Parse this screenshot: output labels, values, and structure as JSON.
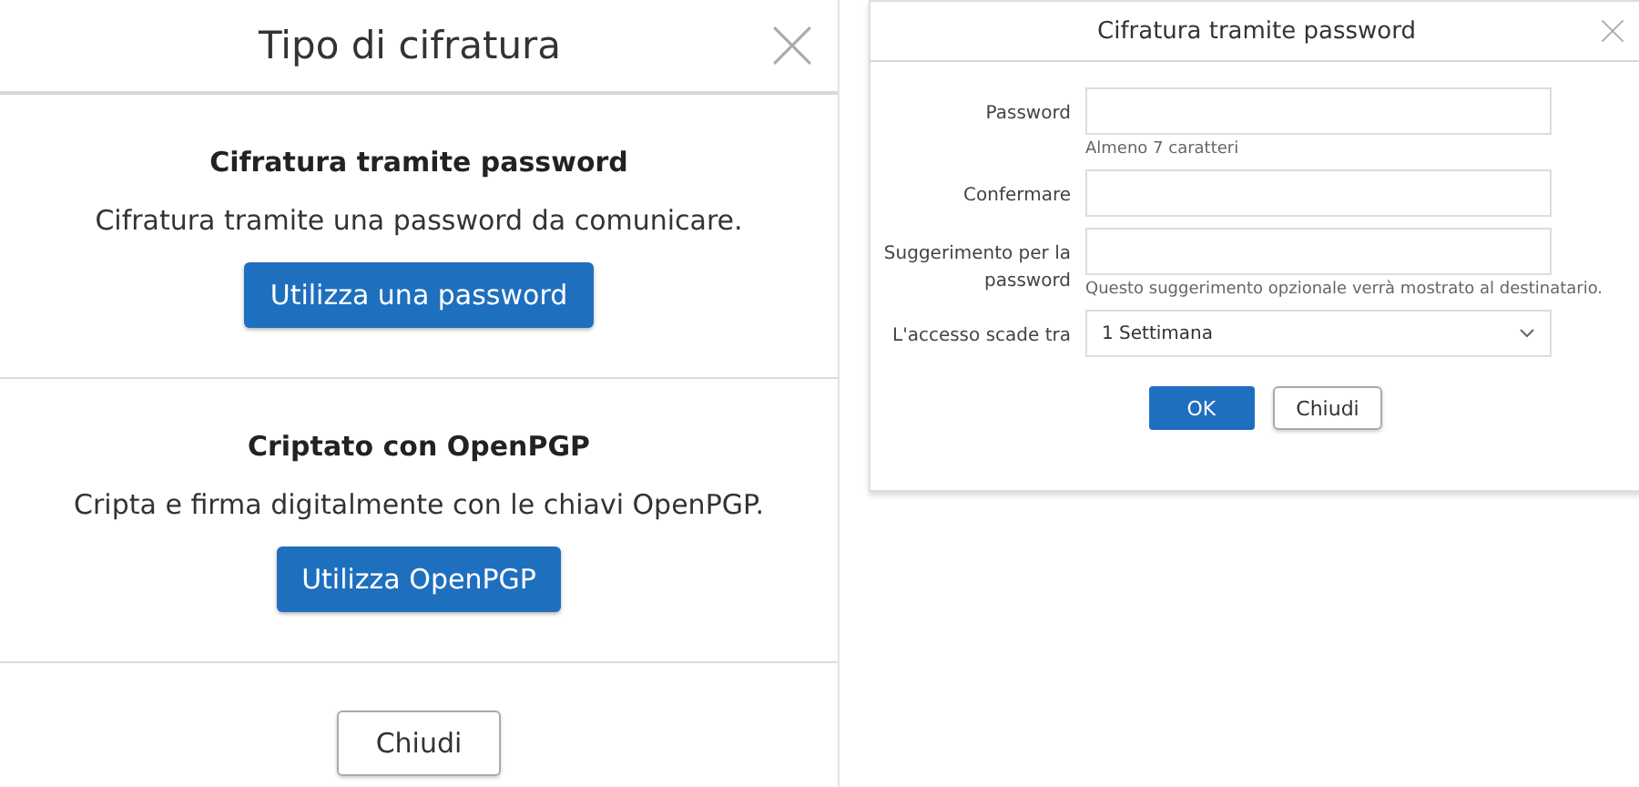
{
  "encryption_type_dialog": {
    "title": "Tipo di cifratura",
    "sections": [
      {
        "heading": "Cifratura tramite password",
        "description": "Cifratura tramite una password da comunicare.",
        "button": "Utilizza una password"
      },
      {
        "heading": "Criptato con OpenPGP",
        "description": "Cripta e firma digitalmente con le chiavi OpenPGP.",
        "button": "Utilizza OpenPGP"
      }
    ],
    "footer_button": "Chiudi"
  },
  "password_dialog": {
    "title": "Cifratura tramite password",
    "fields": [
      {
        "kind": "text",
        "label": "Password",
        "hint": "Almeno 7 caratteri"
      },
      {
        "kind": "text",
        "label": "Confermare"
      },
      {
        "kind": "text",
        "label": "Suggerimento per la password",
        "hint": "Questo suggerimento opzionale verrà mostrato al destinatario."
      },
      {
        "kind": "select",
        "label": "L'accesso scade tra",
        "value": "1 Settimana"
      }
    ],
    "buttons": [
      {
        "label": "OK",
        "primary": true
      },
      {
        "label": "Chiudi",
        "primary": false
      }
    ]
  }
}
